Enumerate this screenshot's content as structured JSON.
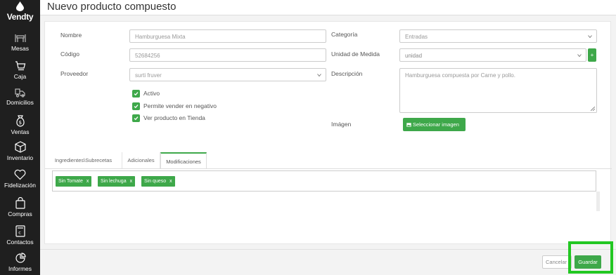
{
  "brand": {
    "name": "Vendty"
  },
  "sidebar": {
    "items": [
      {
        "label": "Mesas",
        "icon": "table-icon"
      },
      {
        "label": "Caja",
        "icon": "cart-icon"
      },
      {
        "label": "Domicilios",
        "icon": "delivery-icon"
      },
      {
        "label": "Ventas",
        "icon": "money-bag-icon"
      },
      {
        "label": "Inventario",
        "icon": "box-icon"
      },
      {
        "label": "Fidelización",
        "icon": "heart-icon"
      },
      {
        "label": "Compras",
        "icon": "shopping-bag-icon"
      },
      {
        "label": "Contactos",
        "icon": "contacts-icon"
      },
      {
        "label": "Informes",
        "icon": "pie-chart-icon"
      }
    ]
  },
  "modal": {
    "title": "Nuevo producto compuesto"
  },
  "form": {
    "nombre": {
      "label": "Nombre",
      "value": "Hamburguesa Mixta"
    },
    "codigo": {
      "label": "Código",
      "value": "52684256"
    },
    "proveedor": {
      "label": "Proveedor",
      "value": "surti fruver"
    },
    "categoria": {
      "label": "Categoría",
      "value": "Entradas"
    },
    "unidad": {
      "label": "Unidad de Medida",
      "value": "unidad",
      "add_label": "+"
    },
    "descripcion": {
      "label": "Descripción",
      "value": "Hamburguesa compuesta por Carne y pollo."
    },
    "imagen": {
      "label": "Imágen",
      "button_label": "Seleccionar imagen"
    },
    "checks": [
      {
        "label": "Activo",
        "checked": true
      },
      {
        "label": "Permite vender en negativo",
        "checked": true
      },
      {
        "label": "Ver producto en Tienda",
        "checked": true
      }
    ]
  },
  "tabs": [
    {
      "label": "Ingredientes\\Subrecetas",
      "active": false
    },
    {
      "label": "Adicionales",
      "active": false
    },
    {
      "label": "Modificaciones",
      "active": true
    }
  ],
  "modifications": [
    {
      "label": "Sin Tomate",
      "remove": "x"
    },
    {
      "label": "Sin lechuga",
      "remove": "x"
    },
    {
      "label": "Sin queso",
      "remove": "x"
    }
  ],
  "footer": {
    "cancel_label": "Cancelar",
    "save_label": "Guardar"
  },
  "colors": {
    "accent": "#3ea84a",
    "sidebar": "#1f1f1f",
    "highlight": "#22c722"
  }
}
